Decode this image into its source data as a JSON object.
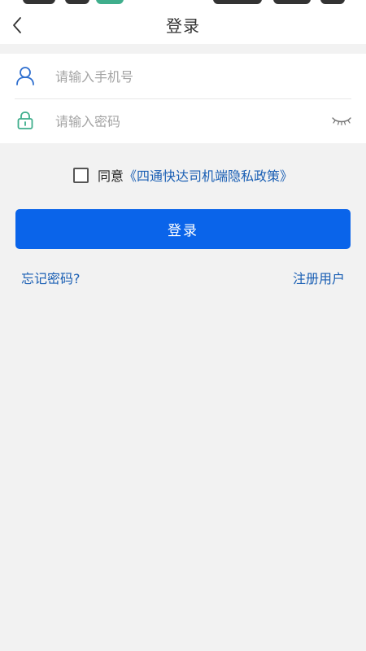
{
  "header": {
    "title": "登录"
  },
  "form": {
    "phone_placeholder": "请输入手机号",
    "phone_value": "",
    "password_placeholder": "请输入密码",
    "password_value": ""
  },
  "agreement": {
    "checked": false,
    "agree_text": "同意",
    "policy_link": "《四通快达司机端隐私政策》"
  },
  "actions": {
    "login_label": "登录",
    "forgot_label": "忘记密码?",
    "register_label": "注册用户"
  },
  "icons": {
    "back": "chevron-left-icon",
    "phone": "user-icon",
    "password": "lock-icon",
    "visibility": "eye-closed-icon"
  },
  "colors": {
    "primary": "#0a64ea",
    "link": "#1a5fb4",
    "user_icon": "#2f6fcf",
    "lock_icon": "#3fae8c",
    "background": "#f2f2f2"
  }
}
